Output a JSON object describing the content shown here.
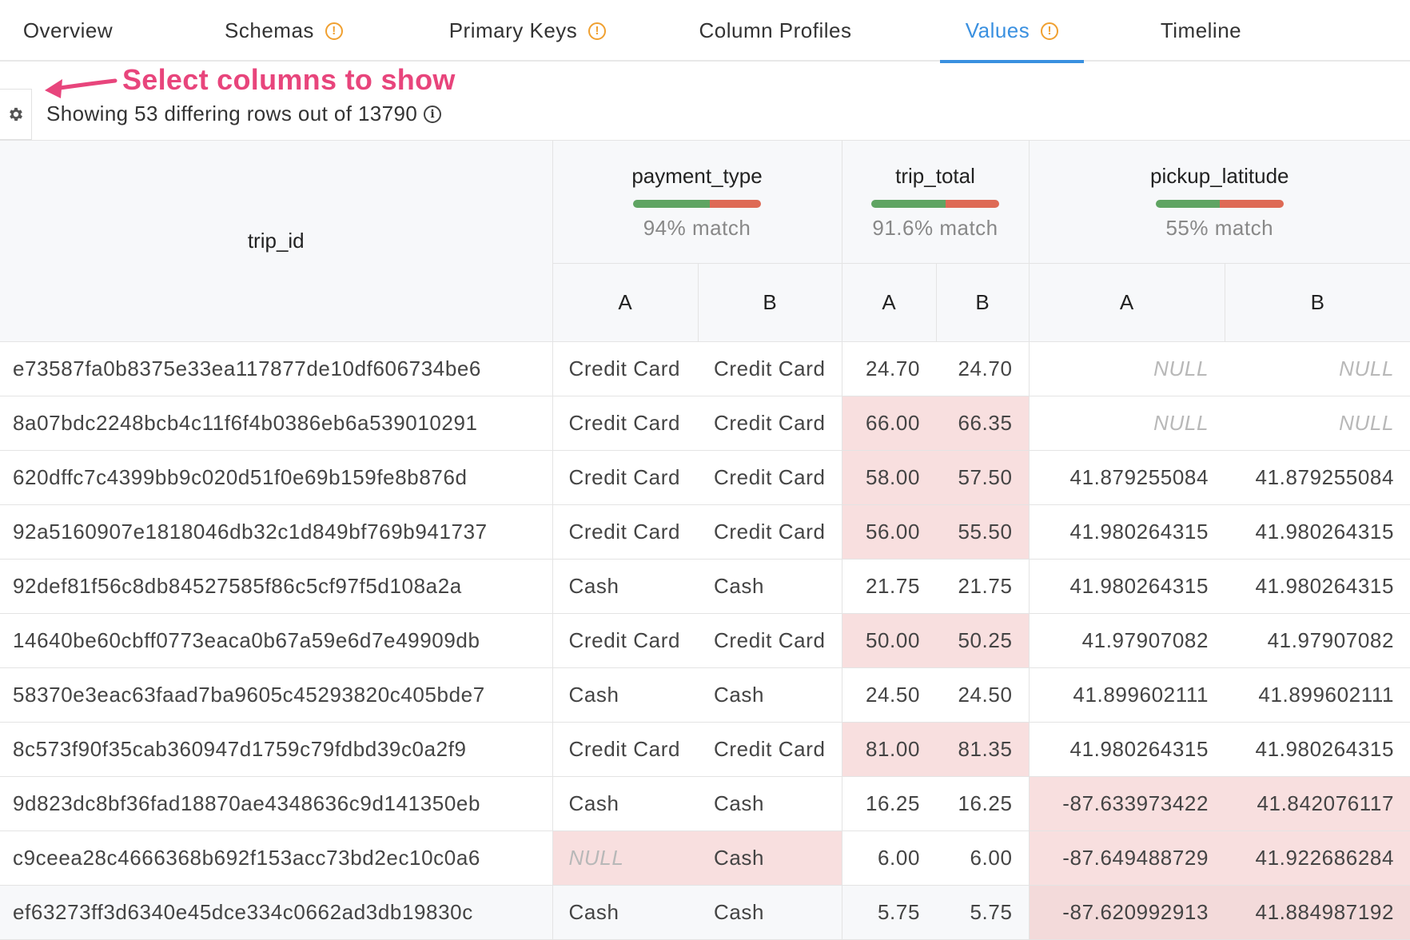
{
  "tabs": [
    {
      "label": "Overview",
      "warning": false,
      "active": false
    },
    {
      "label": "Schemas",
      "warning": true,
      "active": false
    },
    {
      "label": "Primary Keys",
      "warning": true,
      "active": false
    },
    {
      "label": "Column Profiles",
      "warning": false,
      "active": false
    },
    {
      "label": "Values",
      "warning": true,
      "active": true
    },
    {
      "label": "Timeline",
      "warning": false,
      "active": false
    }
  ],
  "toolbar": {
    "annotation": "Select columns to show",
    "status": "Showing 53 differing rows out of 13790"
  },
  "table": {
    "key_column": "trip_id",
    "columns": [
      {
        "name": "payment_type",
        "match_label": "94% match",
        "match_fraction": 0.6
      },
      {
        "name": "trip_total",
        "match_label": "91.6% match",
        "match_fraction": 0.58
      },
      {
        "name": "pickup_latitude",
        "match_label": "55% match",
        "match_fraction": 0.5
      }
    ],
    "sub_a": "A",
    "sub_b": "B",
    "rows": [
      {
        "id": "e73587fa0b8375e33ea117877de10df606734be6",
        "pa": "Credit Card",
        "pb": "Credit Card",
        "ta": "24.70",
        "tb": "24.70",
        "la": "NULL",
        "lb": "NULL",
        "pdiff": false,
        "tdiff": false,
        "ldiff": false
      },
      {
        "id": "8a07bdc2248bcb4c11f6f4b0386eb6a539010291",
        "pa": "Credit Card",
        "pb": "Credit Card",
        "ta": "66.00",
        "tb": "66.35",
        "la": "NULL",
        "lb": "NULL",
        "pdiff": false,
        "tdiff": true,
        "ldiff": false
      },
      {
        "id": "620dffc7c4399bb9c020d51f0e69b159fe8b876d",
        "pa": "Credit Card",
        "pb": "Credit Card",
        "ta": "58.00",
        "tb": "57.50",
        "la": "41.879255084",
        "lb": "41.879255084",
        "pdiff": false,
        "tdiff": true,
        "ldiff": false
      },
      {
        "id": "92a5160907e1818046db32c1d849bf769b941737",
        "pa": "Credit Card",
        "pb": "Credit Card",
        "ta": "56.00",
        "tb": "55.50",
        "la": "41.980264315",
        "lb": "41.980264315",
        "pdiff": false,
        "tdiff": true,
        "ldiff": false
      },
      {
        "id": "92def81f56c8db84527585f86c5cf97f5d108a2a",
        "pa": "Cash",
        "pb": "Cash",
        "ta": "21.75",
        "tb": "21.75",
        "la": "41.980264315",
        "lb": "41.980264315",
        "pdiff": false,
        "tdiff": false,
        "ldiff": false
      },
      {
        "id": "14640be60cbff0773eaca0b67a59e6d7e49909db",
        "pa": "Credit Card",
        "pb": "Credit Card",
        "ta": "50.00",
        "tb": "50.25",
        "la": "41.97907082",
        "lb": "41.97907082",
        "pdiff": false,
        "tdiff": true,
        "ldiff": false
      },
      {
        "id": "58370e3eac63faad7ba9605c45293820c405bde7",
        "pa": "Cash",
        "pb": "Cash",
        "ta": "24.50",
        "tb": "24.50",
        "la": "41.899602111",
        "lb": "41.899602111",
        "pdiff": false,
        "tdiff": false,
        "ldiff": false
      },
      {
        "id": "8c573f90f35cab360947d1759c79fdbd39c0a2f9",
        "pa": "Credit Card",
        "pb": "Credit Card",
        "ta": "81.00",
        "tb": "81.35",
        "la": "41.980264315",
        "lb": "41.980264315",
        "pdiff": false,
        "tdiff": true,
        "ldiff": false
      },
      {
        "id": "9d823dc8bf36fad18870ae4348636c9d141350eb",
        "pa": "Cash",
        "pb": "Cash",
        "ta": "16.25",
        "tb": "16.25",
        "la": "-87.633973422",
        "lb": "41.842076117",
        "pdiff": false,
        "tdiff": false,
        "ldiff": true
      },
      {
        "id": "c9ceea28c4666368b692f153acc73bd2ec10c0a6",
        "pa": "NULL",
        "pb": "Cash",
        "ta": "6.00",
        "tb": "6.00",
        "la": "-87.649488729",
        "lb": "41.922686284",
        "pdiff": true,
        "tdiff": false,
        "ldiff": true
      },
      {
        "id": "ef63273ff3d6340e45dce334c0662ad3db19830c",
        "pa": "Cash",
        "pb": "Cash",
        "ta": "5.75",
        "tb": "5.75",
        "la": "-87.620992913",
        "lb": "41.884987192",
        "pdiff": false,
        "tdiff": false,
        "ldiff": true
      }
    ]
  },
  "colors": {
    "accent": "#3a90e0",
    "warning": "#f0a030",
    "annotation": "#e8457c",
    "match_green": "#5fa462",
    "match_red": "#de6a55",
    "diff_bg": "#f8dfdf"
  }
}
